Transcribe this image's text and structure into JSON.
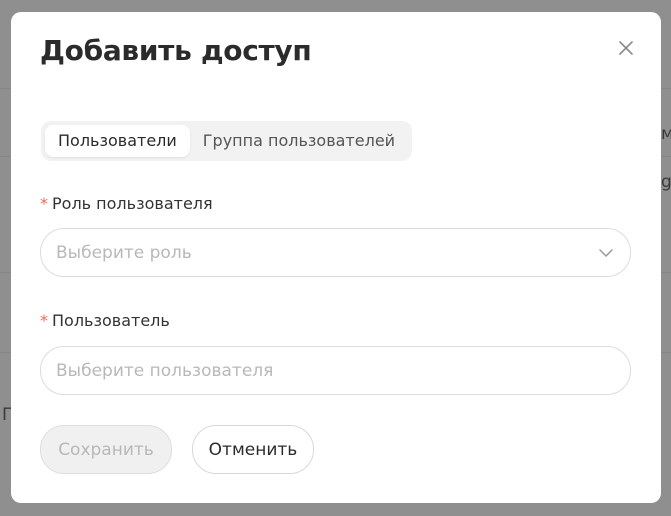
{
  "background": {
    "fragments": [
      "м",
      "g",
      "Г"
    ]
  },
  "dialog": {
    "title": "Добавить доступ",
    "close_icon": "close-icon",
    "tabs": [
      {
        "label": "Пользователи",
        "active": true
      },
      {
        "label": "Группа пользователей",
        "active": false
      }
    ],
    "role_field": {
      "required_mark": "*",
      "label": "Роль пользователя",
      "placeholder": "Выберите роль",
      "icon": "chevron-down-icon"
    },
    "user_field": {
      "required_mark": "*",
      "label": "Пользователь",
      "placeholder": "Выберите пользователя"
    },
    "buttons": {
      "save_label": "Сохранить",
      "cancel_label": "Отменить"
    }
  },
  "colors": {
    "overlay": "#8f8f8f",
    "required": "#ef6a55",
    "placeholder": "#b8b8b8",
    "title": "#2b2b2b"
  }
}
